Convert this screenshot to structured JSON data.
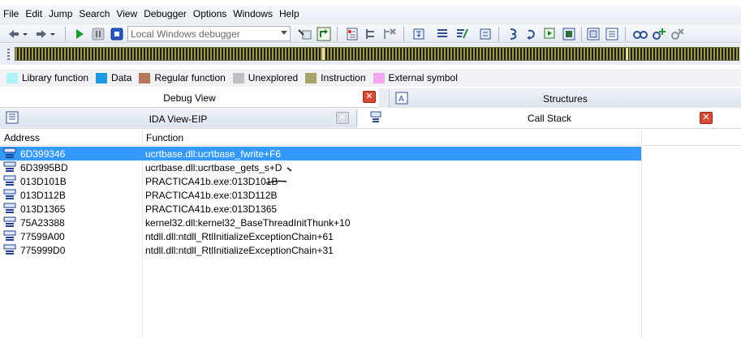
{
  "menu": [
    "File",
    "Edit",
    "Jump",
    "Search",
    "View",
    "Debugger",
    "Options",
    "Windows",
    "Help"
  ],
  "toolbar": {
    "debugger_select": "Local Windows debugger"
  },
  "legend": [
    {
      "label": "Library function",
      "color": "#aef4f6"
    },
    {
      "label": "Data",
      "color": "#1e9ae0"
    },
    {
      "label": "Regular function",
      "color": "#b5765a"
    },
    {
      "label": "Unexplored",
      "color": "#c0c0c0"
    },
    {
      "label": "Instruction",
      "color": "#a9a56a"
    },
    {
      "label": "External symbol",
      "color": "#f5a8f2"
    }
  ],
  "tabs": {
    "debug_view": "Debug View",
    "structures": "Structures",
    "ida_view": "IDA View-EIP",
    "call_stack": "Call Stack"
  },
  "call_stack": {
    "columns": {
      "address": "Address",
      "function": "Function"
    },
    "rows": [
      {
        "address": "6D399346",
        "function": "ucrtbase.dll:ucrtbase_fwrite+F6"
      },
      {
        "address": "6D3995BD",
        "function": "ucrtbase.dll:ucrtbase_gets_s+D"
      },
      {
        "address": "013D101B",
        "function": "PRACTICA41b.exe:013D101B"
      },
      {
        "address": "013D112B",
        "function": "PRACTICA41b.exe:013D112B"
      },
      {
        "address": "013D1365",
        "function": "PRACTICA41b.exe:013D1365"
      },
      {
        "address": "75A23388",
        "function": "kernel32.dll:kernel32_BaseThreadInitThunk+10"
      },
      {
        "address": "77599A00",
        "function": "ntdll.dll:ntdll_RtlInitializeExceptionChain+61"
      },
      {
        "address": "775999D0",
        "function": "ntdll.dll:ntdll_RtlInitializeExceptionChain+31"
      }
    ]
  }
}
